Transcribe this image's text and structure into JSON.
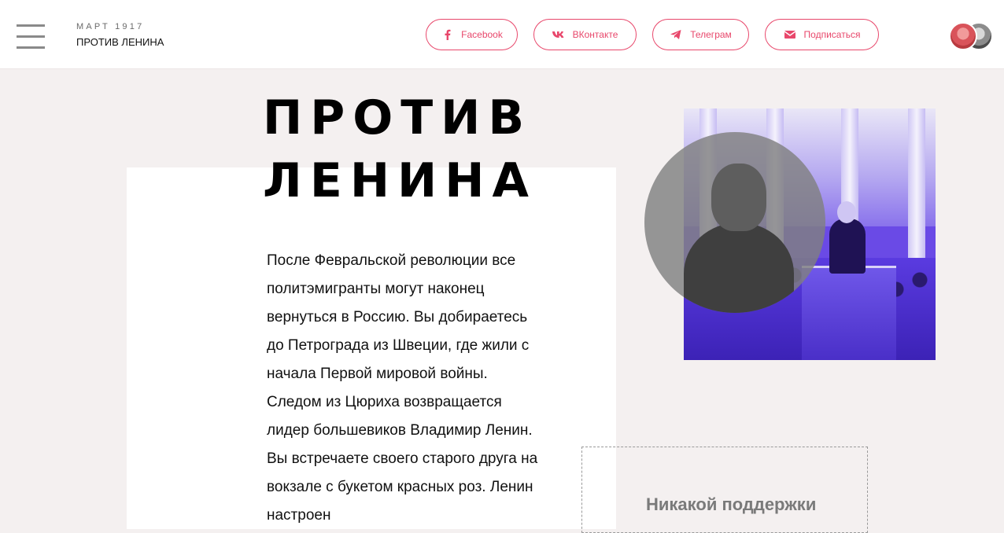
{
  "header": {
    "kicker": "МАРТ 1917",
    "title": "ПРОТИВ ЛЕНИНА",
    "share": [
      {
        "label": "Facebook",
        "icon": "facebook-icon"
      },
      {
        "label": "ВКонтакте",
        "icon": "vk-icon"
      },
      {
        "label": "Телеграм",
        "icon": "telegram-icon"
      },
      {
        "label": "Подписаться",
        "icon": "mail-icon"
      }
    ],
    "accent_color": "#e8476b"
  },
  "article": {
    "headline_line1": "ПРОТИВ",
    "headline_line2": "ЛЕНИНА",
    "intro": "После Февральской революции все политэмигранты могут наконец вернуться в Россию. Вы добираетесь до Петрограда из Швеции, где жили с начала Первой мировой войны. Следом из Цюриха возвращается лидер большевиков Владимир Ленин. Вы встречаете своего старого друга на вокзале с букетом красных роз. Ленин настроен"
  },
  "sidebar": {
    "title": "Никакой поддержки"
  }
}
